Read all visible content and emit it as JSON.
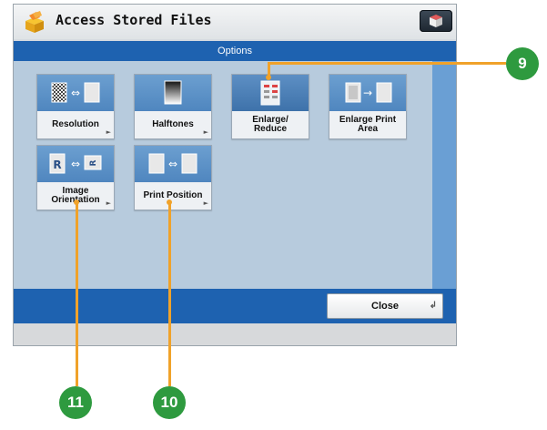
{
  "window": {
    "title": "Access Stored Files",
    "dialog_title": "Options"
  },
  "options": [
    {
      "label": "Resolution",
      "icon": "resolution-icon"
    },
    {
      "label": "Halftones",
      "icon": "halftones-icon"
    },
    {
      "label": "Enlarge/\nReduce",
      "icon": "enlarge-reduce-icon"
    },
    {
      "label": "Enlarge Print\nArea",
      "icon": "enlarge-print-area-icon"
    },
    {
      "label": "Image\nOrientation",
      "icon": "image-orientation-icon"
    },
    {
      "label": "Print Position",
      "icon": "print-position-icon"
    }
  ],
  "footer": {
    "close_label": "Close"
  },
  "callouts": {
    "enlarge_reduce": "9",
    "print_position": "10",
    "image_orientation": "11"
  },
  "colors": {
    "header_blue": "#1e62b0",
    "callout_green": "#2e9a3f",
    "leader_orange": "#f0a22a"
  }
}
